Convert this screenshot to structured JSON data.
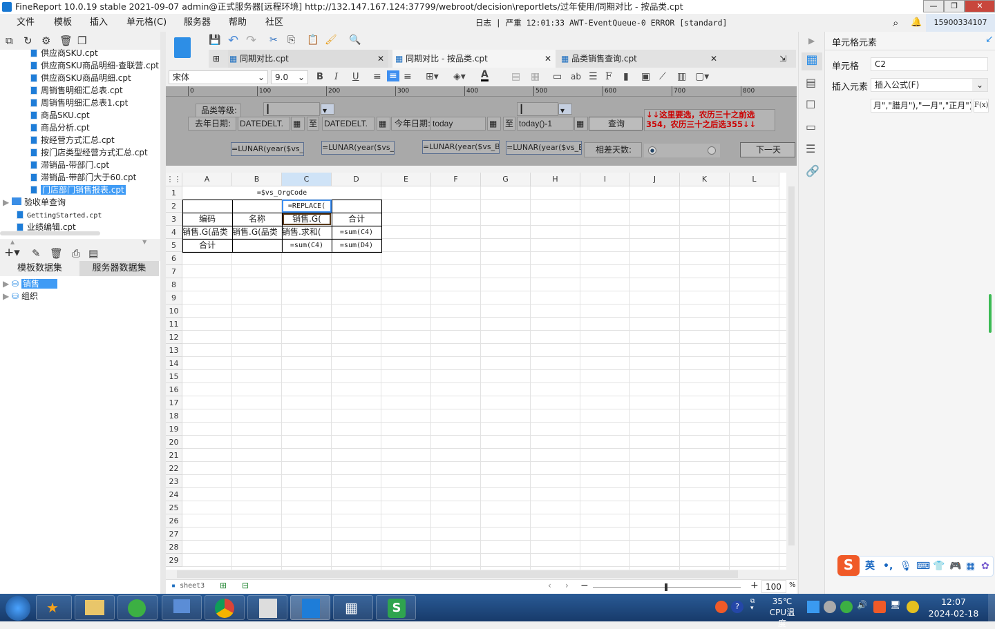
{
  "title": "FineReport 10.0.19 stable 2021-09-07 admin@正式服务器[远程环境]    http://132.147.167.124:37799/webroot/decision\\reportlets/过年使用/同期对比 - 按品类.cpt",
  "menu": [
    "文件",
    "模板",
    "插入",
    "单元格(C)",
    "服务器",
    "帮助",
    "社区"
  ],
  "log": "日志 | 严重 12:01:33 AWT-EventQueue-0 ERROR [standard]",
  "user_phone": "15900334107",
  "tree": [
    {
      "label": "供应商SKU.cpt"
    },
    {
      "label": "供应商SKU商品明细-查联营.cpt"
    },
    {
      "label": "供应商SKU商品明细.cpt"
    },
    {
      "label": "周销售明细汇总表.cpt"
    },
    {
      "label": "周销售明细汇总表1.cpt"
    },
    {
      "label": "商品SKU.cpt"
    },
    {
      "label": "商品分析.cpt"
    },
    {
      "label": "按经营方式汇总.cpt"
    },
    {
      "label": "按门店类型经营方式汇总.cpt"
    },
    {
      "label": "滞销品-带部门.cpt"
    },
    {
      "label": "滞销品-带部门大于60.cpt"
    },
    {
      "label": "门店部门销售报表.cpt"
    }
  ],
  "tree_folder": "验收单查询",
  "tree_root_files": [
    "GettingStarted.cpt",
    "业绩编辑.cpt"
  ],
  "dataset_tabs": [
    "模板数据集",
    "服务器数据集"
  ],
  "datasets": [
    "销售",
    "组织"
  ],
  "tabs": [
    "同期对比.cpt",
    "同期对比 - 按品类.cpt",
    "品类销售查询.cpt"
  ],
  "font": {
    "name": "宋体",
    "size": "9.0"
  },
  "ruler": [
    "0",
    "100",
    "200",
    "300",
    "400",
    "500",
    "600",
    "700",
    "800"
  ],
  "params": {
    "category_label": "品类等级:",
    "last_year_label": "去年日期:",
    "to1": "至",
    "this_year_label": "今年日期:",
    "to2": "至",
    "d1": "DATEDELT.",
    "d2": "DATEDELT.",
    "d3": "today",
    "d4": "today()-1",
    "query": "查询",
    "note": "↓↓这里要选，农历三十之前选354，农历三十之后选355↓↓",
    "l1": "=LUNAR(year($vs_B",
    "l2": "=LUNAR(year($vs_En",
    "l3": "=LUNAR(year($vs_Bg",
    "l4": "=LUNAR(year($vs_En",
    "diff_label": "相差天数:",
    "next": "下一天"
  },
  "columns": [
    "A",
    "B",
    "C",
    "D",
    "E",
    "F",
    "G",
    "H",
    "I",
    "J",
    "K",
    "L"
  ],
  "row_count": 29,
  "cells": {
    "a1": "=$vs_OrgCode",
    "c2": "=REPLACE(",
    "a3": "编码",
    "b3": "名称",
    "c3": "销售.G(",
    "d3": "合计",
    "a4": "销售.G(品类",
    "b4": "销售.G(品类",
    "c4": "销售.求和(",
    "d4": "=sum(C4)",
    "a5": "合计",
    "c5": "=sum(C4)",
    "d5": "=sum(D4)"
  },
  "sheet": "sheet3",
  "zoom": "100",
  "zoom_unit": "%",
  "right": {
    "title": "单元格元素",
    "cell_label": "单元格",
    "cell_value": "C2",
    "insert_label": "插入元素",
    "insert_value": "插入公式(F)",
    "formula": "月\",\"腊月\"),\"一月\",\"正月\")",
    "fx": "F(x)"
  },
  "ime": {
    "lang": "英",
    "punct": "•,"
  },
  "tray": {
    "temp": "35℃",
    "temp_label": "CPU温度",
    "time": "12:07",
    "date": "2024-02-18"
  }
}
